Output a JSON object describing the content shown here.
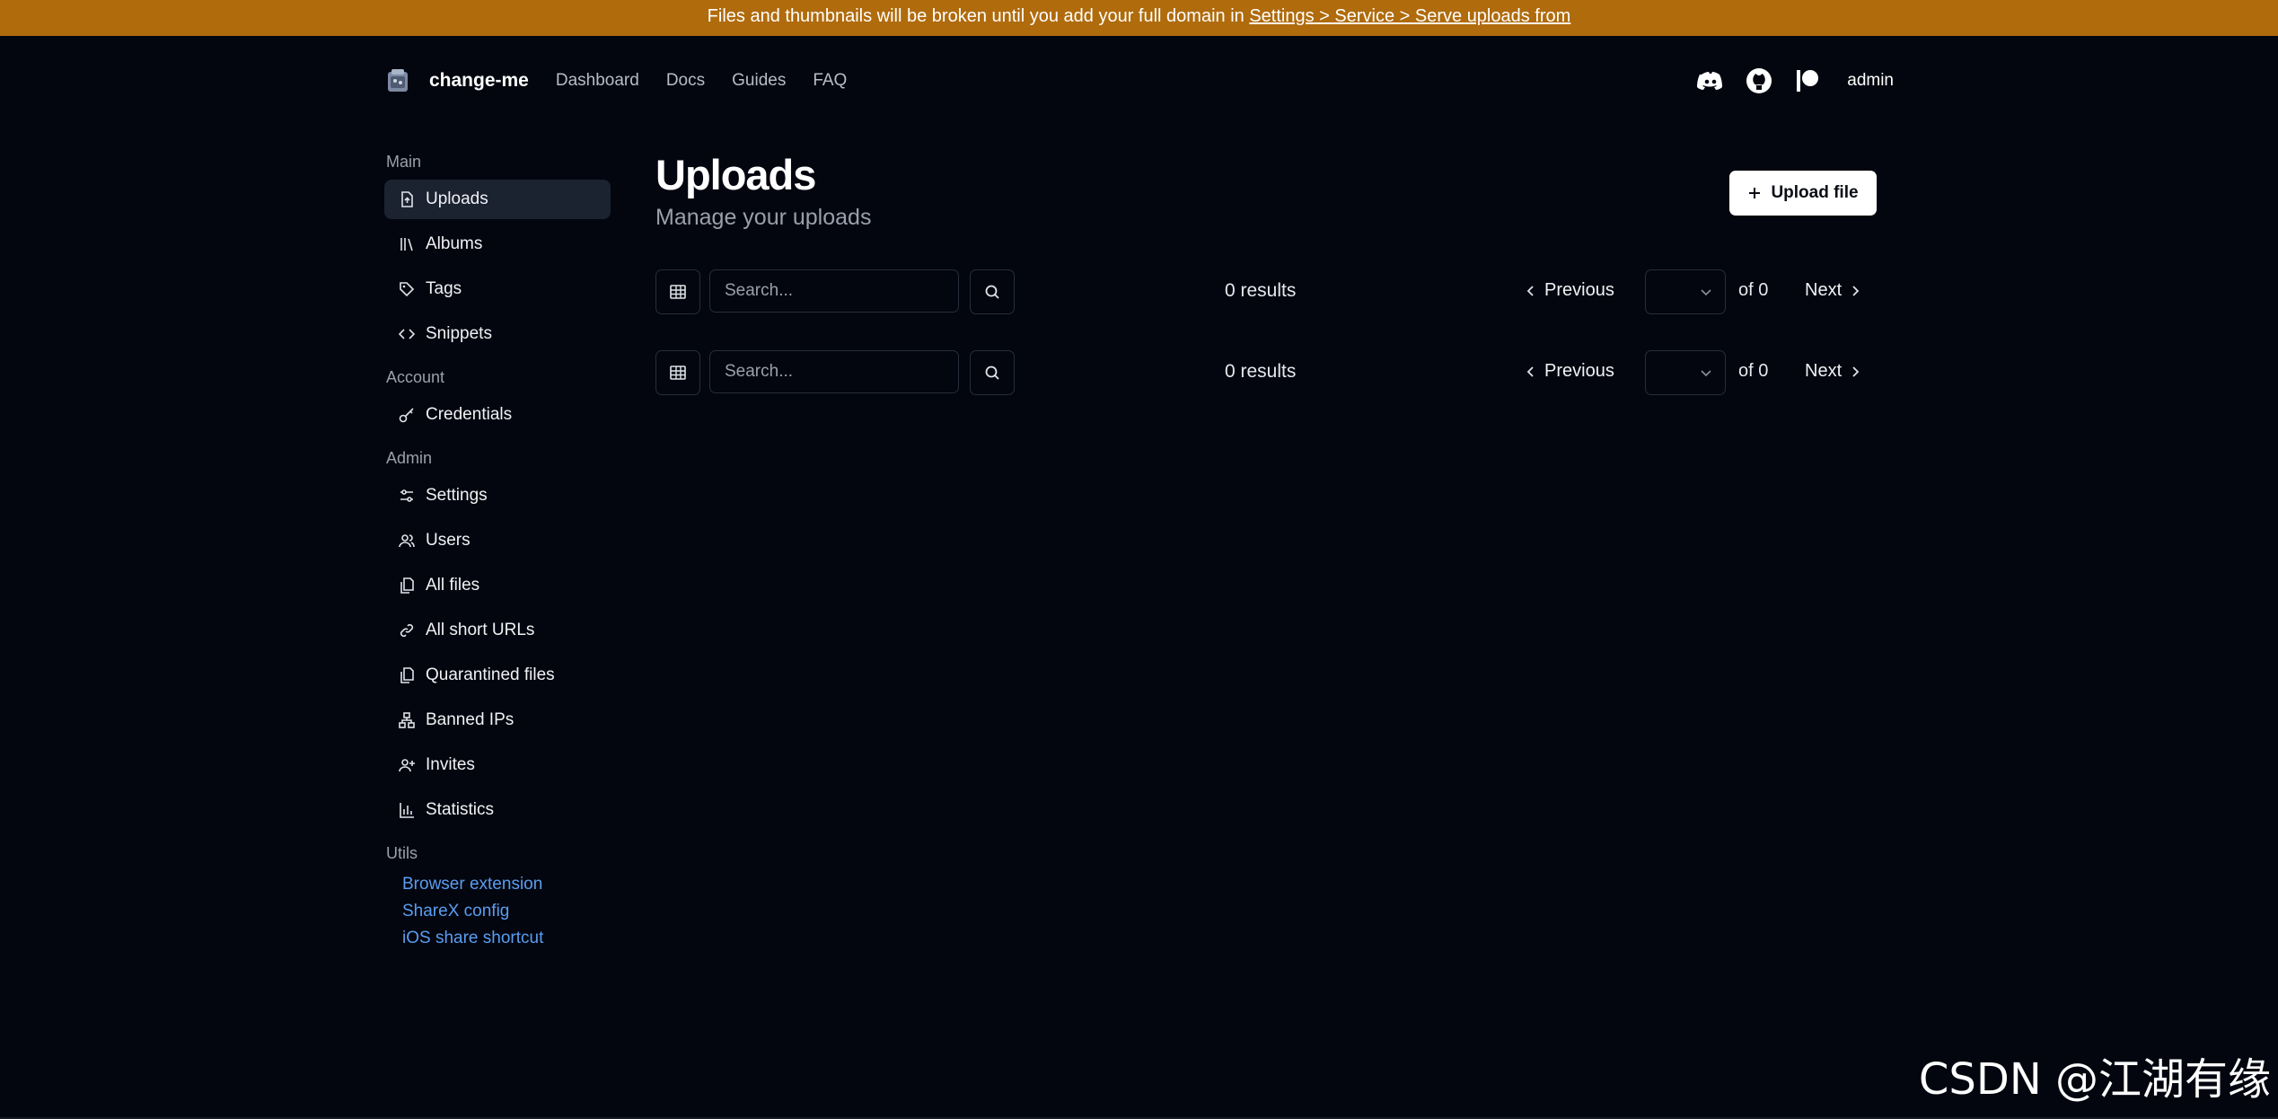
{
  "banner": {
    "text": "Files and thumbnails will be broken until you add your full domain in",
    "link": "Settings > Service > Serve uploads from"
  },
  "nav": {
    "brand": "change-me",
    "links": [
      "Dashboard",
      "Docs",
      "Guides",
      "FAQ"
    ],
    "user": "admin",
    "icons": [
      "discord-icon",
      "github-icon",
      "patreon-icon"
    ]
  },
  "sidebar": {
    "main_label": "Main",
    "main_items": [
      "Uploads",
      "Albums",
      "Tags",
      "Snippets"
    ],
    "account_label": "Account",
    "account_items": [
      "Credentials"
    ],
    "admin_label": "Admin",
    "admin_items": [
      "Settings",
      "Users",
      "All files",
      "All short URLs",
      "Quarantined files",
      "Banned IPs",
      "Invites",
      "Statistics"
    ],
    "utils_label": "Utils",
    "utils_items": [
      "Browser extension",
      "ShareX config",
      "iOS share shortcut"
    ]
  },
  "page": {
    "title": "Uploads",
    "subtitle": "Manage your uploads",
    "upload_button": "Upload file"
  },
  "toolbar": {
    "search_placeholder": "Search...",
    "results": "0 results",
    "previous": "Previous",
    "of": "of 0",
    "next": "Next"
  },
  "colors": {
    "banner": "#b06b0c",
    "background": "#03060f",
    "active_item": "#1b2230",
    "link": "#5b9df0"
  },
  "watermark": "CSDN @江湖有缘"
}
